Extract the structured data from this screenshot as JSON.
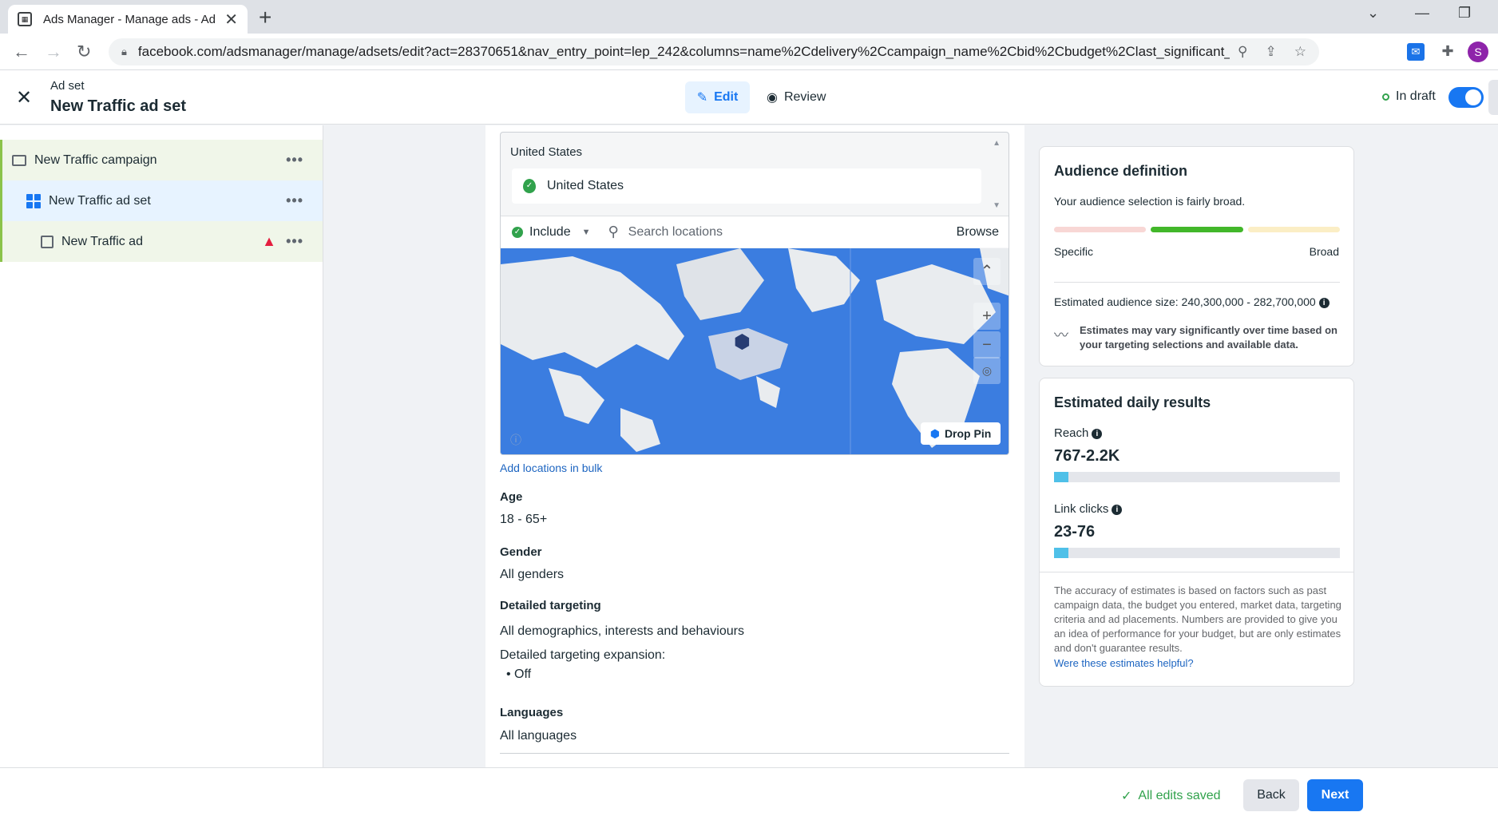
{
  "browser": {
    "tab_title": "Ads Manager - Manage ads - Ad",
    "url": "facebook.com/adsmanager/manage/adsets/edit?act=28370651&nav_entry_point=lep_242&columns=name%2Cdelivery%2Ccampaign_name%2Cbid%2Cbudget%2Clast_significant_edit...",
    "profile_initial": "S"
  },
  "header": {
    "subtitle": "Ad set",
    "title": "New Traffic ad set",
    "edit_label": "Edit",
    "review_label": "Review",
    "status_label": "In draft"
  },
  "sidebar": {
    "campaign": "New Traffic campaign",
    "adset": "New Traffic ad set",
    "ad": "New Traffic ad",
    "more_glyph": "•••"
  },
  "location": {
    "group_label": "United States",
    "selected": "United States",
    "include_label": "Include",
    "search_placeholder": "Search locations",
    "browse_label": "Browse",
    "drop_pin_label": "Drop Pin",
    "bulk_link": "Add locations in bulk"
  },
  "targeting": {
    "age_label": "Age",
    "age_value": "18 - 65+",
    "gender_label": "Gender",
    "gender_value": "All genders",
    "detailed_label": "Detailed targeting",
    "detailed_value": "All demographics, interests and behaviours",
    "expansion_label": "Detailed targeting expansion:",
    "expansion_value": "Off",
    "languages_label": "Languages",
    "languages_value": "All languages"
  },
  "audience": {
    "title": "Audience definition",
    "description": "Your audience selection is fairly broad.",
    "specific_label": "Specific",
    "broad_label": "Broad",
    "size_text": "Estimated audience size: 240,300,000 - 282,700,000",
    "note": "Estimates may vary significantly over time based on your targeting selections and available data.",
    "meter_colors": [
      "#f8d7d5",
      "#42b72a",
      "#fbeec5"
    ]
  },
  "daily_results": {
    "title": "Estimated daily results",
    "reach_label": "Reach",
    "reach_value": "767-2.2K",
    "reach_fill": 0.05,
    "clicks_label": "Link clicks",
    "clicks_value": "23-76",
    "clicks_fill": 0.05,
    "disclaimer": "The accuracy of estimates is based on factors such as past campaign data, the budget you entered, market data, targeting criteria and ad placements. Numbers are provided to give you an idea of performance for your budget, but are only estimates and don't guarantee results.",
    "helpful_link": "Were these estimates helpful?"
  },
  "footer": {
    "saved_label": "All edits saved",
    "back_label": "Back",
    "next_label": "Next"
  },
  "colors": {
    "accent": "#1877f2",
    "success": "#31a24c",
    "warning": "#e41e3f"
  }
}
